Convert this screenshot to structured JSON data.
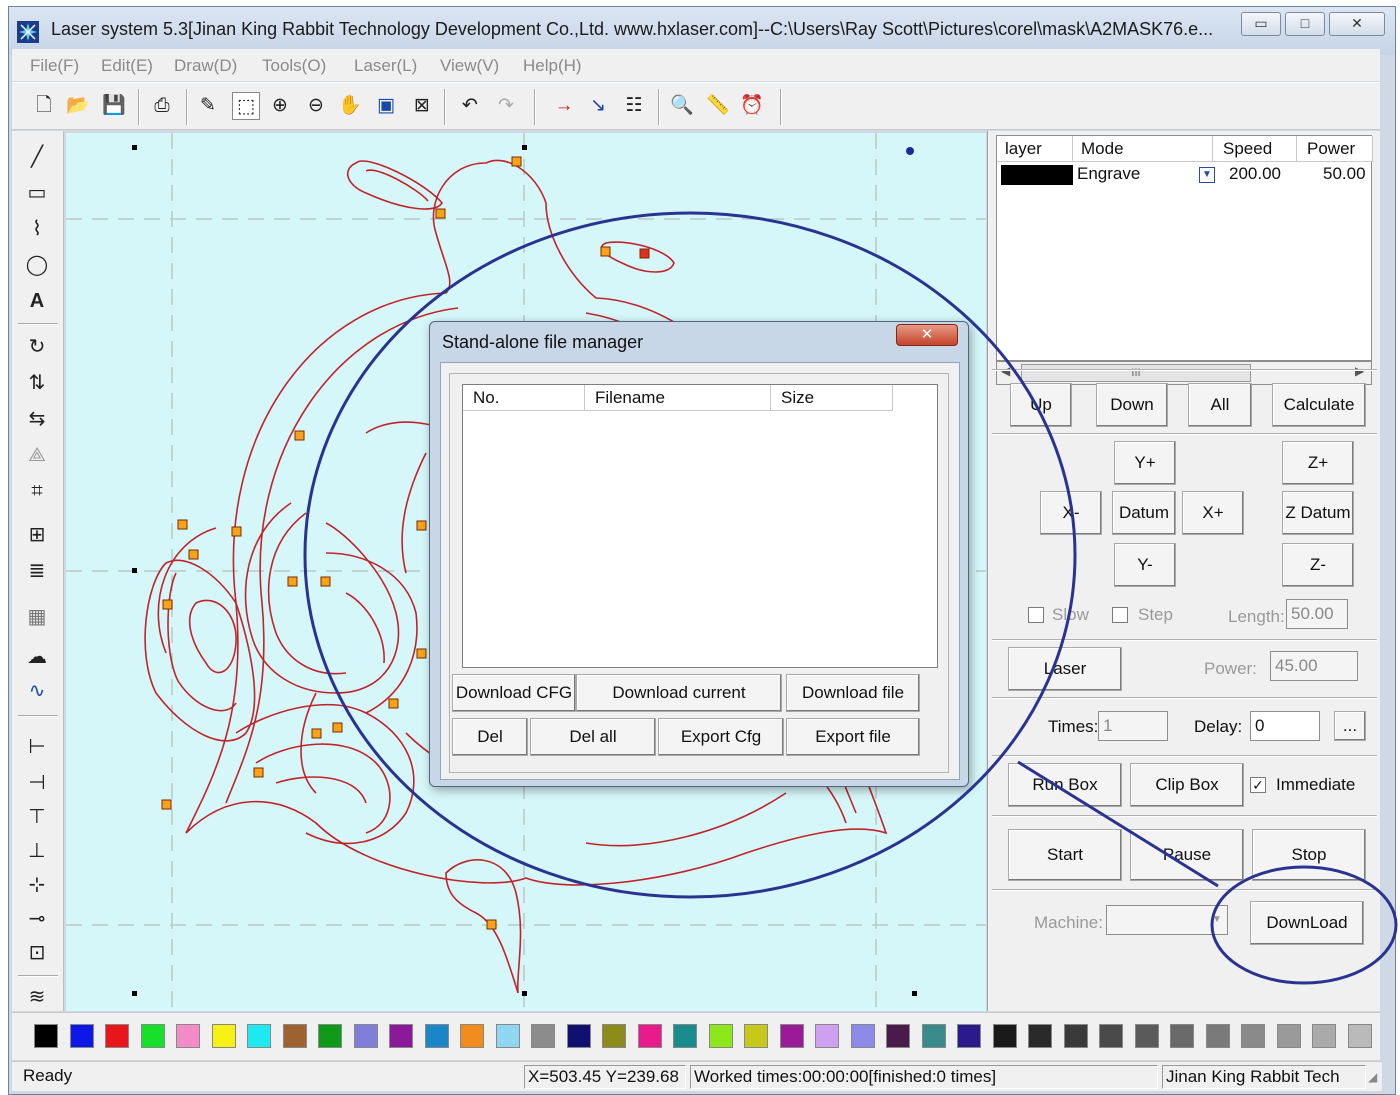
{
  "window": {
    "title": "Laser system 5.3[Jinan King Rabbit Technology Development Co.,Ltd. www.hxlaser.com]--C:\\Users\\Ray Scott\\Pictures\\corel\\mask\\A2MASK76.e...",
    "minimize": "▭",
    "maximize": "□",
    "close": "✕"
  },
  "menu": [
    "File(F)",
    "Edit(E)",
    "Draw(D)",
    "Tools(O)",
    "Laser(L)",
    "View(V)",
    "Help(H)"
  ],
  "layer_table": {
    "headers": [
      "layer",
      "Mode",
      "Speed",
      "Power"
    ],
    "rows": [
      {
        "color": "#000000",
        "mode": "Engrave",
        "speed": "200.00",
        "power": "50.00"
      }
    ],
    "scroll_glyph": "III"
  },
  "controls": {
    "up": "Up",
    "down": "Down",
    "all": "All",
    "calculate": "Calculate",
    "y_plus": "Y+",
    "y_minus": "Y-",
    "x_minus": "X-",
    "x_plus": "X+",
    "datum": "Datum",
    "z_plus": "Z+",
    "z_datum": "Z Datum",
    "z_minus": "Z-",
    "slow": "Slow",
    "step": "Step",
    "length_label": "Length:",
    "length_value": "50.00",
    "laser": "Laser",
    "power_label": "Power:",
    "power_value": "45.00",
    "times_label": "Times:",
    "times_value": "1",
    "delay_label": "Delay:",
    "delay_value": "0",
    "more": "...",
    "run_box": "Run Box",
    "clip_box": "Clip Box",
    "immediate": "Immediate",
    "start": "Start",
    "pause": "Pause",
    "stop": "Stop",
    "machine_label": "Machine:",
    "machine_value": "",
    "download": "DownLoad"
  },
  "dialog": {
    "title": "Stand-alone file manager",
    "close": "✕",
    "columns": [
      "No.",
      "Filename",
      "Size"
    ],
    "buttons_row1": [
      "Download CFG",
      "Download current",
      "Download file"
    ],
    "buttons_row2": [
      "Del",
      "Del all",
      "Export Cfg",
      "Export file"
    ]
  },
  "palette": [
    "#000000",
    "#0d17e6",
    "#e8161c",
    "#17e02a",
    "#f28bc8",
    "#f7f114",
    "#1ee8f0",
    "#9e6230",
    "#0f9a1a",
    "#7f7fd9",
    "#8a1a9a",
    "#1a86c8",
    "#f28c1e",
    "#8fd7f0",
    "#8c8c8c",
    "#101070",
    "#8c8c1a",
    "#e81a8c",
    "#1a8c8c",
    "#8ce81a",
    "#c8c81a",
    "#9a1a9a",
    "#d0a0f0",
    "#8c8ce8",
    "#4a1a4a",
    "#3a8c8c",
    "#2a1a8c",
    "#1a1a1a",
    "#2a2a2a",
    "#3a3a3a",
    "#4a4a4a",
    "#5a5a5a",
    "#6a6a6a",
    "#7a7a7a",
    "#8a8a8a",
    "#9a9a9a",
    "#aaaaaa",
    "#bababa"
  ],
  "status": {
    "ready": "Ready",
    "coords": "X=503.45 Y=239.68",
    "worked": "Worked times:00:00:00[finished:0 times]",
    "company": "Jinan King Rabbit Tech"
  }
}
